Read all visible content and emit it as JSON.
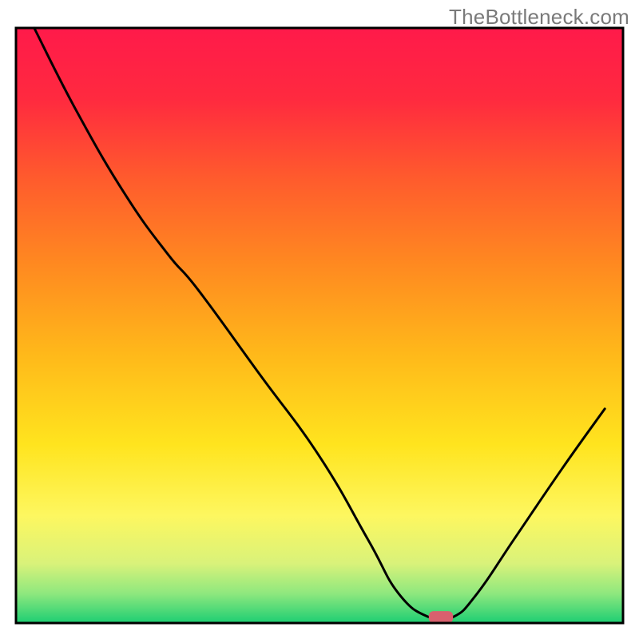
{
  "watermark": "TheBottleneck.com",
  "chart_data": {
    "type": "line",
    "title": "",
    "xlabel": "",
    "ylabel": "",
    "xlim": [
      0,
      100
    ],
    "ylim": [
      0,
      100
    ],
    "background": {
      "gradient_stops": [
        {
          "offset": 0.0,
          "color": "#ff1a4a"
        },
        {
          "offset": 0.12,
          "color": "#ff2a3f"
        },
        {
          "offset": 0.25,
          "color": "#ff5a2d"
        },
        {
          "offset": 0.4,
          "color": "#ff8a20"
        },
        {
          "offset": 0.55,
          "color": "#ffb91a"
        },
        {
          "offset": 0.7,
          "color": "#ffe41e"
        },
        {
          "offset": 0.82,
          "color": "#fdf760"
        },
        {
          "offset": 0.9,
          "color": "#d9f27a"
        },
        {
          "offset": 0.95,
          "color": "#8fe87e"
        },
        {
          "offset": 1.0,
          "color": "#1dce73"
        }
      ]
    },
    "series": [
      {
        "name": "bottleneck-curve",
        "color": "#000000",
        "width": 3,
        "points": [
          {
            "x": 3,
            "y": 100
          },
          {
            "x": 10,
            "y": 86
          },
          {
            "x": 18,
            "y": 72
          },
          {
            "x": 25,
            "y": 62
          },
          {
            "x": 30,
            "y": 56
          },
          {
            "x": 40,
            "y": 42
          },
          {
            "x": 50,
            "y": 28
          },
          {
            "x": 58,
            "y": 14
          },
          {
            "x": 63,
            "y": 5
          },
          {
            "x": 68,
            "y": 1
          },
          {
            "x": 72,
            "y": 1
          },
          {
            "x": 76,
            "y": 5
          },
          {
            "x": 82,
            "y": 14
          },
          {
            "x": 90,
            "y": 26
          },
          {
            "x": 97,
            "y": 36
          }
        ]
      }
    ],
    "marker": {
      "name": "optimal-point",
      "x": 70,
      "y": 1,
      "width": 4,
      "height": 2,
      "color": "#d9606e"
    },
    "frame": {
      "color": "#000000",
      "width": 3
    }
  }
}
